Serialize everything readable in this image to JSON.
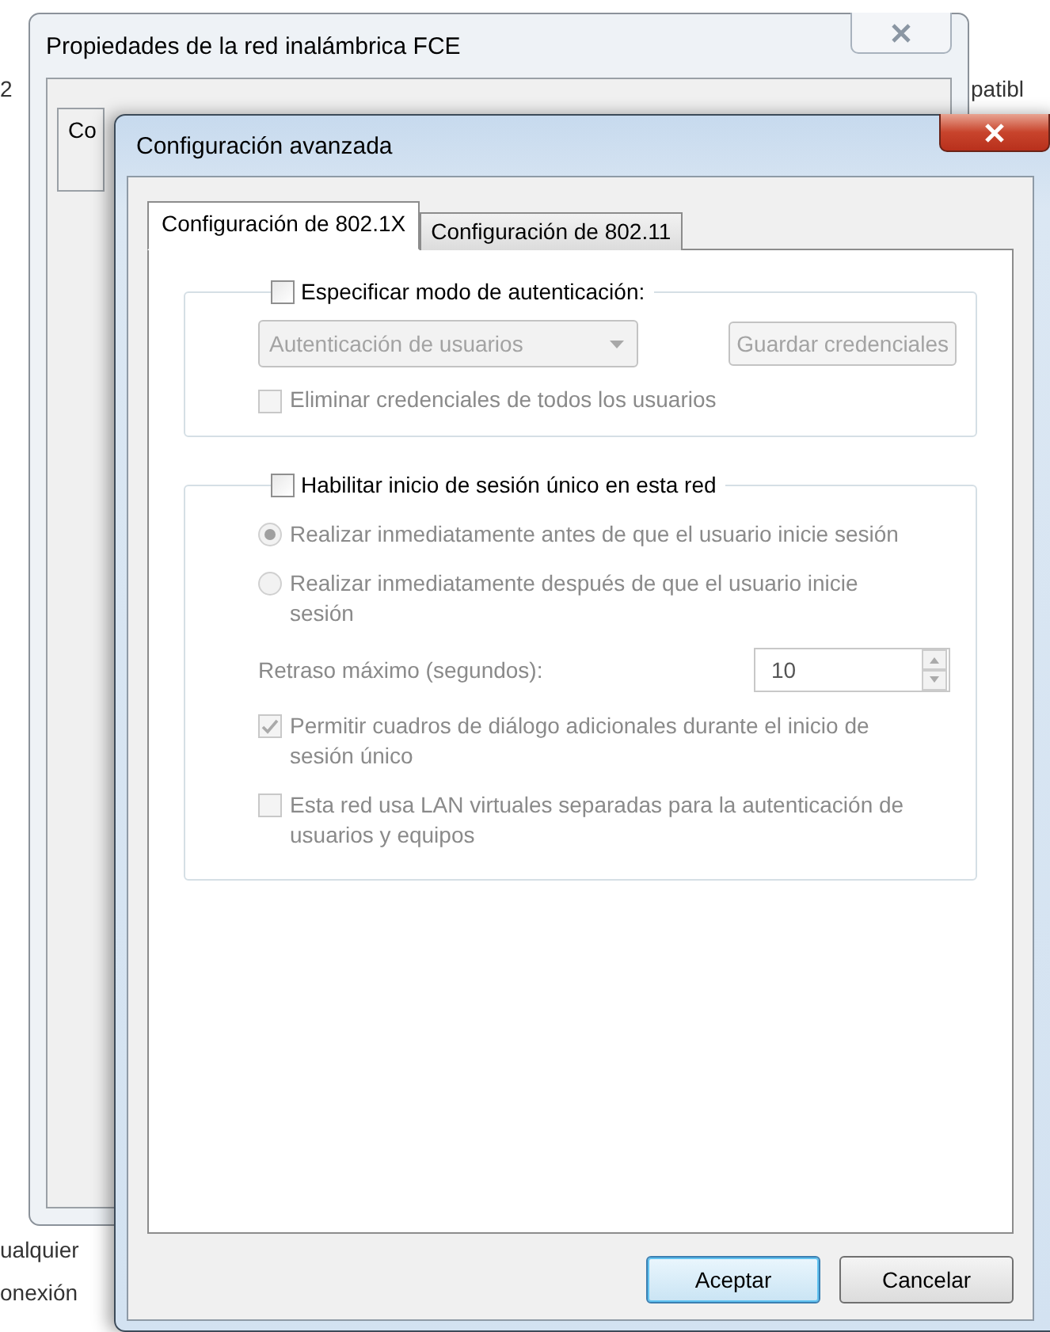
{
  "back_window": {
    "title": "Propiedades de la red inalámbrica FCE",
    "tab": "Co",
    "edge_texts": [
      "2",
      "patibl",
      "ualquier",
      "onexión"
    ]
  },
  "dialog": {
    "title": "Configuración avanzada",
    "tabs": [
      {
        "label": "Configuración de 802.1X",
        "selected": true
      },
      {
        "label": "Configuración de 802.11",
        "selected": false
      }
    ],
    "auth_group": {
      "label": "Especificar modo de autenticación:",
      "checked": false,
      "mode_dropdown": {
        "value": "Autenticación de usuarios",
        "disabled": true
      },
      "save_button": {
        "label": "Guardar credenciales",
        "disabled": true
      },
      "delete_option": {
        "label": "Eliminar credenciales de todos los usuarios",
        "checked": false,
        "disabled": true
      }
    },
    "sso_group": {
      "label": "Habilitar inicio de sesión único en esta red",
      "checked": false,
      "timing": [
        {
          "label": "Realizar inmediatamente antes de que el usuario inicie sesión",
          "selected": true,
          "disabled": true
        },
        {
          "label": "Realizar inmediatamente después de que el usuario inicie sesión",
          "selected": false,
          "disabled": true
        }
      ],
      "delay": {
        "label": "Retraso máximo (segundos):",
        "value": "10",
        "disabled": true
      },
      "options": [
        {
          "label": "Permitir cuadros de diálogo adicionales durante el inicio de sesión único",
          "checked": true,
          "disabled": true
        },
        {
          "label": "Esta red usa LAN virtuales separadas para la autenticación de usuarios y equipos",
          "checked": false,
          "disabled": true
        }
      ]
    },
    "buttons": [
      {
        "label": "Aceptar",
        "default": true
      },
      {
        "label": "Cancelar",
        "default": false
      }
    ]
  }
}
